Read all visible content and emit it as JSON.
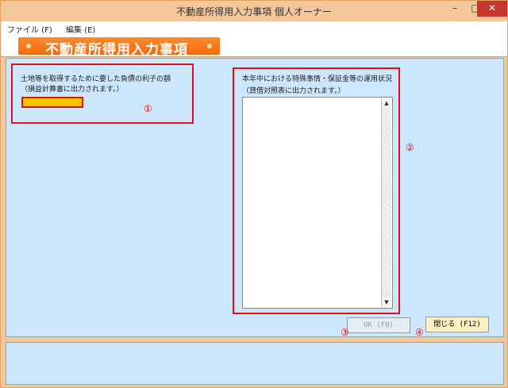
{
  "window": {
    "title": "不動産所得用入力事項 個人オーナー",
    "min_label": "–",
    "max_label": "□",
    "close_label": "✕"
  },
  "menu": {
    "file": "ファイル (F)",
    "edit": "編集 (E)"
  },
  "banner": {
    "title": "不動産所得用入力事項"
  },
  "section1": {
    "label_line1": "土地等を取得するために要した負債の利子の額",
    "label_line2": "（損益計算書に出力されます。）",
    "value": "",
    "marker": "①"
  },
  "section2": {
    "label_line1": "本年中における特殊事情・保証金等の運用状況",
    "label_line2": "（貸借対照表に出力されます。）",
    "value": "",
    "marker": "②",
    "scroll_up": "▲",
    "scroll_down": "▼"
  },
  "buttons": {
    "ok_label": "OK (F8)",
    "ok_marker": "③",
    "close_label": "閉じる (F12)",
    "close_marker": "④"
  },
  "colors": {
    "accent_orange": "#f26a10",
    "highlight_red": "#e0101c",
    "input_yellow": "#f6c400",
    "panel_blue": "#cce6fb"
  }
}
